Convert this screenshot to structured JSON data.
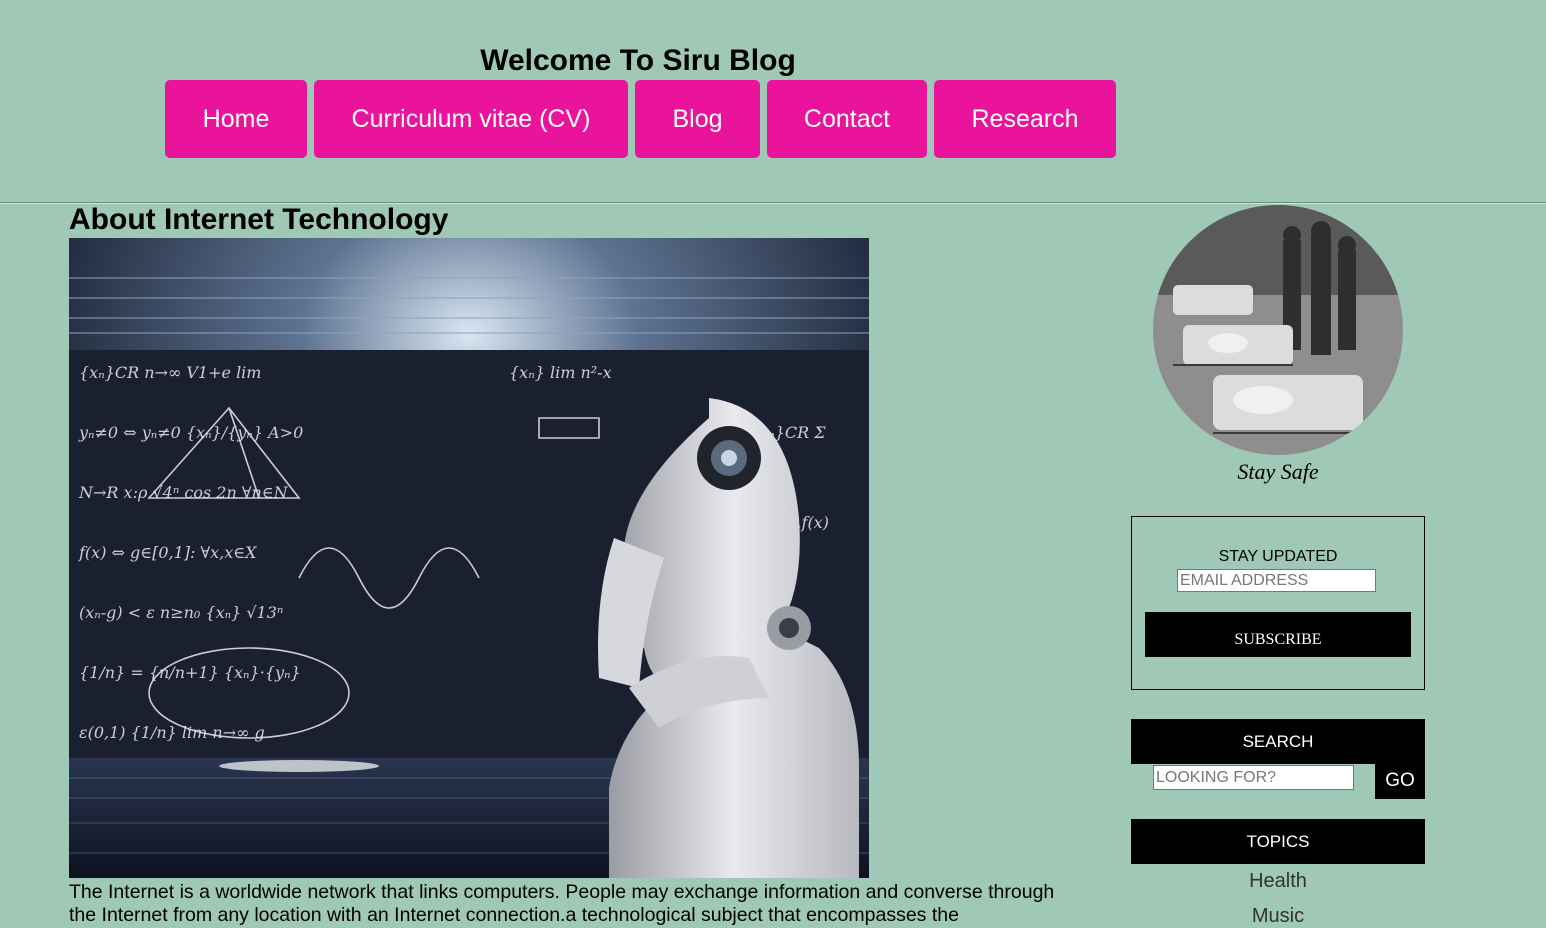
{
  "header": {
    "title": "Welcome To Siru Blog",
    "nav": [
      {
        "label": "Home"
      },
      {
        "label": "Curriculum vitae (CV)"
      },
      {
        "label": "Blog"
      },
      {
        "label": "Contact"
      },
      {
        "label": "Research"
      }
    ]
  },
  "article": {
    "title": "About Internet Technology",
    "body": "The Internet is a worldwide network that links computers. People may exchange information and converse through the Internet from any location with an Internet connection.a technological subject that encompasses the"
  },
  "sidebar": {
    "avatar_caption": "Stay Safe",
    "subscribe": {
      "label": "STAY UPDATED",
      "email_placeholder": "EMAIL ADDRESS",
      "button": "SUBSCRIBE"
    },
    "search": {
      "header": "SEARCH",
      "placeholder": "LOOKING FOR?",
      "button": "GO"
    },
    "topics": {
      "header": "TOPICS",
      "items": [
        {
          "label": "Health"
        },
        {
          "label": "Music"
        }
      ]
    }
  },
  "colors": {
    "background": "#9fc8b6",
    "nav_button": "#ea139c",
    "sidebar_bar": "#000000"
  }
}
